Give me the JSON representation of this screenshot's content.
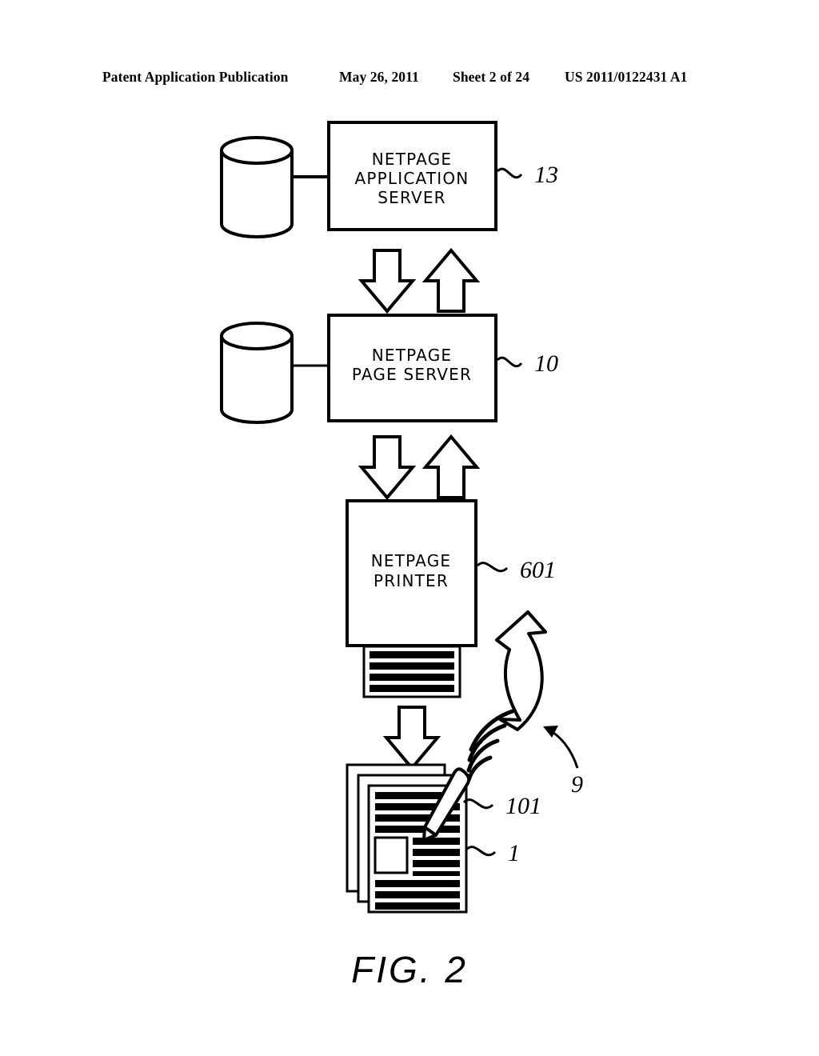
{
  "header": {
    "publication": "Patent Application Publication",
    "date": "May 26, 2011",
    "sheet": "Sheet 2 of 24",
    "document_number": "US 2011/0122431 A1"
  },
  "figure": {
    "caption": "FIG. 2",
    "blocks": [
      {
        "id": "netpage-application-server",
        "label_lines": [
          "NETPAGE",
          "APPLICATION",
          "SERVER"
        ],
        "ref": "13",
        "has_database": true
      },
      {
        "id": "netpage-page-server",
        "label_lines": [
          "NETPAGE",
          "PAGE SERVER"
        ],
        "ref": "10",
        "has_database": true
      },
      {
        "id": "netpage-printer",
        "label_lines": [
          "NETPAGE",
          "PRINTER"
        ],
        "ref": "601",
        "has_database": false
      }
    ],
    "annotations": [
      {
        "id": "netpage-pen",
        "ref": "101"
      },
      {
        "id": "netpage-document",
        "ref": "1"
      },
      {
        "id": "wireless-signal",
        "ref": "9"
      }
    ],
    "connectors": [
      {
        "id": "app-server-to-page-server",
        "type": "bidirectional-block-arrows"
      },
      {
        "id": "page-server-to-printer",
        "type": "bidirectional-block-arrows"
      },
      {
        "id": "printer-to-document",
        "type": "down-block-arrow"
      },
      {
        "id": "pen-to-printer",
        "type": "curved-block-arrow"
      }
    ],
    "colors": {
      "ink": "#000000",
      "paper": "#ffffff"
    }
  }
}
